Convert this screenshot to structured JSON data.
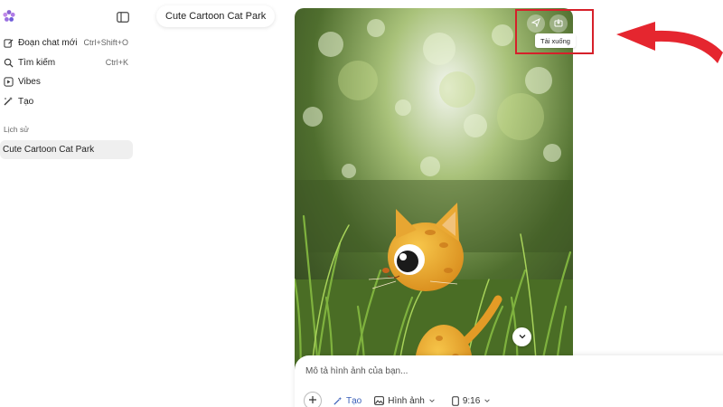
{
  "sidebar": {
    "items": [
      {
        "label": "Đoạn chat mới",
        "shortcut": "Ctrl+Shift+O",
        "icon": "edit-icon"
      },
      {
        "label": "Tìm kiếm",
        "shortcut": "Ctrl+K",
        "icon": "search-icon"
      },
      {
        "label": "Vibes",
        "shortcut": "",
        "icon": "play-icon"
      },
      {
        "label": "Tạo",
        "shortcut": "",
        "icon": "magic-wand-icon"
      }
    ],
    "history_label": "Lịch sử",
    "history": [
      {
        "label": "Cute Cartoon Cat Park"
      }
    ]
  },
  "header": {
    "title": "Cute Cartoon Cat Park"
  },
  "image": {
    "tooltip": "Tải xuống",
    "actions": [
      "share-icon",
      "download-icon"
    ]
  },
  "composer": {
    "placeholder": "Mô tả hình ảnh của bạn...",
    "mode_label": "Tạo",
    "type_label": "Hình ảnh",
    "ratio_label": "9:16"
  },
  "colors": {
    "accent": "#3a5fb8",
    "highlight": "#d6202a"
  }
}
